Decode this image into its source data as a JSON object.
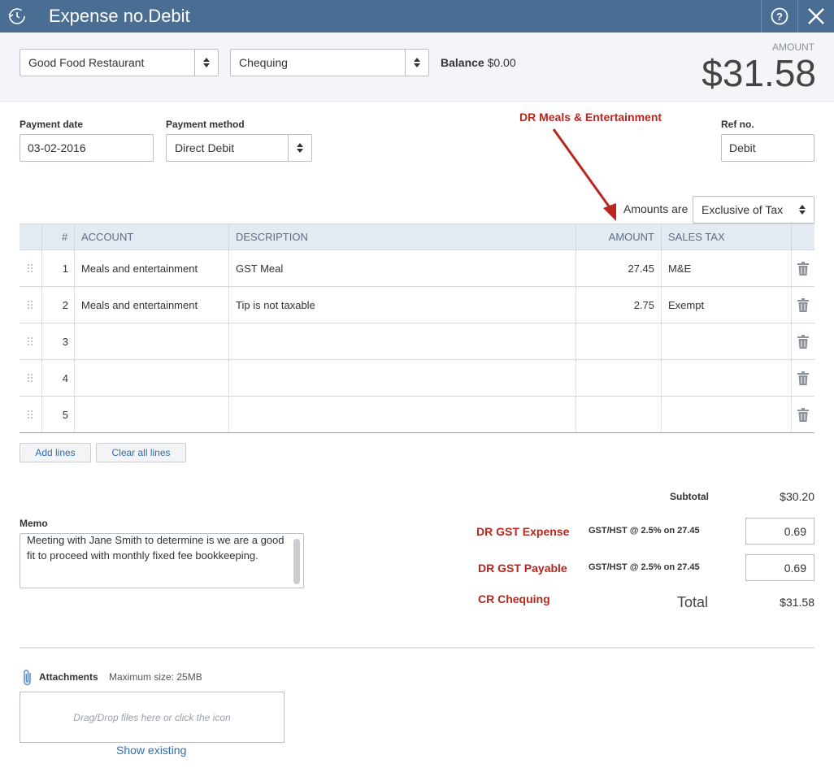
{
  "titlebar": {
    "title": "Expense no.Debit",
    "history_icon": "history-clock-icon",
    "help_icon": "question-circle-icon",
    "close_icon": "close-icon"
  },
  "header": {
    "payee": "Good Food Restaurant",
    "account": "Chequing",
    "balance_label": "Balance",
    "balance_value": "$0.00",
    "amount_label": "AMOUNT",
    "amount_value": "$31.58"
  },
  "details": {
    "payment_date_label": "Payment date",
    "payment_date": "03-02-2016",
    "payment_method_label": "Payment method",
    "payment_method": "Direct Debit",
    "ref_label": "Ref no.",
    "ref_value": "Debit",
    "amounts_are_label": "Amounts are",
    "amounts_are": "Exclusive of Tax"
  },
  "annotations": {
    "dr_meals": "DR Meals & Entertainment",
    "dr_gst_expense": "DR GST Expense",
    "dr_gst_payable": "DR GST Payable",
    "cr_chequing": "CR Chequing",
    "arrow_color": "#b8261d"
  },
  "table": {
    "headers": [
      "#",
      "ACCOUNT",
      "DESCRIPTION",
      "AMOUNT",
      "SALES TAX"
    ],
    "rows": [
      {
        "num": "1",
        "account": "Meals and entertainment",
        "description": "GST Meal",
        "amount": "27.45",
        "tax": "M&E"
      },
      {
        "num": "2",
        "account": "Meals and entertainment",
        "description": "Tip is not taxable",
        "amount": "2.75",
        "tax": "Exempt"
      },
      {
        "num": "3",
        "account": "",
        "description": "",
        "amount": "",
        "tax": ""
      },
      {
        "num": "4",
        "account": "",
        "description": "",
        "amount": "",
        "tax": ""
      },
      {
        "num": "5",
        "account": "",
        "description": "",
        "amount": "",
        "tax": ""
      }
    ],
    "add_lines": "Add lines",
    "clear_lines": "Clear all lines"
  },
  "memo": {
    "label": "Memo",
    "text": "Meeting with Jane Smith to determine is we are a good fit to proceed with monthly fixed fee bookkeeping."
  },
  "totals": {
    "subtotal_label": "Subtotal",
    "subtotal": "$30.20",
    "tax1_label": "GST/HST @ 2.5% on 27.45",
    "tax1_value": "0.69",
    "tax2_label": "GST/HST @ 2.5% on 27.45",
    "tax2_value": "0.69",
    "total_label": "Total",
    "total": "$31.58"
  },
  "attachments": {
    "label": "Attachments",
    "max_size": "Maximum size: 25MB",
    "drop_text": "Drag/Drop files here or click the icon",
    "show_existing": "Show existing"
  },
  "colors": {
    "titlebar": "#4a6d94",
    "annotation_red": "#b8261d",
    "link_blue": "#2f6bb5"
  }
}
